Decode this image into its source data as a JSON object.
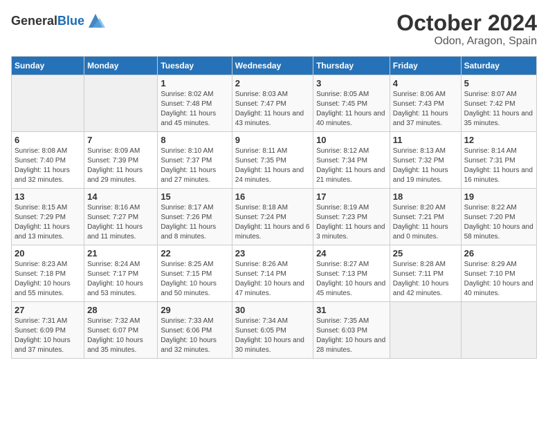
{
  "header": {
    "logo_general": "General",
    "logo_blue": "Blue",
    "title": "October 2024",
    "subtitle": "Odon, Aragon, Spain"
  },
  "days_of_week": [
    "Sunday",
    "Monday",
    "Tuesday",
    "Wednesday",
    "Thursday",
    "Friday",
    "Saturday"
  ],
  "weeks": [
    [
      {
        "day": "",
        "info": ""
      },
      {
        "day": "",
        "info": ""
      },
      {
        "day": "1",
        "info": "Sunrise: 8:02 AM\nSunset: 7:48 PM\nDaylight: 11 hours and 45 minutes."
      },
      {
        "day": "2",
        "info": "Sunrise: 8:03 AM\nSunset: 7:47 PM\nDaylight: 11 hours and 43 minutes."
      },
      {
        "day": "3",
        "info": "Sunrise: 8:05 AM\nSunset: 7:45 PM\nDaylight: 11 hours and 40 minutes."
      },
      {
        "day": "4",
        "info": "Sunrise: 8:06 AM\nSunset: 7:43 PM\nDaylight: 11 hours and 37 minutes."
      },
      {
        "day": "5",
        "info": "Sunrise: 8:07 AM\nSunset: 7:42 PM\nDaylight: 11 hours and 35 minutes."
      }
    ],
    [
      {
        "day": "6",
        "info": "Sunrise: 8:08 AM\nSunset: 7:40 PM\nDaylight: 11 hours and 32 minutes."
      },
      {
        "day": "7",
        "info": "Sunrise: 8:09 AM\nSunset: 7:39 PM\nDaylight: 11 hours and 29 minutes."
      },
      {
        "day": "8",
        "info": "Sunrise: 8:10 AM\nSunset: 7:37 PM\nDaylight: 11 hours and 27 minutes."
      },
      {
        "day": "9",
        "info": "Sunrise: 8:11 AM\nSunset: 7:35 PM\nDaylight: 11 hours and 24 minutes."
      },
      {
        "day": "10",
        "info": "Sunrise: 8:12 AM\nSunset: 7:34 PM\nDaylight: 11 hours and 21 minutes."
      },
      {
        "day": "11",
        "info": "Sunrise: 8:13 AM\nSunset: 7:32 PM\nDaylight: 11 hours and 19 minutes."
      },
      {
        "day": "12",
        "info": "Sunrise: 8:14 AM\nSunset: 7:31 PM\nDaylight: 11 hours and 16 minutes."
      }
    ],
    [
      {
        "day": "13",
        "info": "Sunrise: 8:15 AM\nSunset: 7:29 PM\nDaylight: 11 hours and 13 minutes."
      },
      {
        "day": "14",
        "info": "Sunrise: 8:16 AM\nSunset: 7:27 PM\nDaylight: 11 hours and 11 minutes."
      },
      {
        "day": "15",
        "info": "Sunrise: 8:17 AM\nSunset: 7:26 PM\nDaylight: 11 hours and 8 minutes."
      },
      {
        "day": "16",
        "info": "Sunrise: 8:18 AM\nSunset: 7:24 PM\nDaylight: 11 hours and 6 minutes."
      },
      {
        "day": "17",
        "info": "Sunrise: 8:19 AM\nSunset: 7:23 PM\nDaylight: 11 hours and 3 minutes."
      },
      {
        "day": "18",
        "info": "Sunrise: 8:20 AM\nSunset: 7:21 PM\nDaylight: 11 hours and 0 minutes."
      },
      {
        "day": "19",
        "info": "Sunrise: 8:22 AM\nSunset: 7:20 PM\nDaylight: 10 hours and 58 minutes."
      }
    ],
    [
      {
        "day": "20",
        "info": "Sunrise: 8:23 AM\nSunset: 7:18 PM\nDaylight: 10 hours and 55 minutes."
      },
      {
        "day": "21",
        "info": "Sunrise: 8:24 AM\nSunset: 7:17 PM\nDaylight: 10 hours and 53 minutes."
      },
      {
        "day": "22",
        "info": "Sunrise: 8:25 AM\nSunset: 7:15 PM\nDaylight: 10 hours and 50 minutes."
      },
      {
        "day": "23",
        "info": "Sunrise: 8:26 AM\nSunset: 7:14 PM\nDaylight: 10 hours and 47 minutes."
      },
      {
        "day": "24",
        "info": "Sunrise: 8:27 AM\nSunset: 7:13 PM\nDaylight: 10 hours and 45 minutes."
      },
      {
        "day": "25",
        "info": "Sunrise: 8:28 AM\nSunset: 7:11 PM\nDaylight: 10 hours and 42 minutes."
      },
      {
        "day": "26",
        "info": "Sunrise: 8:29 AM\nSunset: 7:10 PM\nDaylight: 10 hours and 40 minutes."
      }
    ],
    [
      {
        "day": "27",
        "info": "Sunrise: 7:31 AM\nSunset: 6:09 PM\nDaylight: 10 hours and 37 minutes."
      },
      {
        "day": "28",
        "info": "Sunrise: 7:32 AM\nSunset: 6:07 PM\nDaylight: 10 hours and 35 minutes."
      },
      {
        "day": "29",
        "info": "Sunrise: 7:33 AM\nSunset: 6:06 PM\nDaylight: 10 hours and 32 minutes."
      },
      {
        "day": "30",
        "info": "Sunrise: 7:34 AM\nSunset: 6:05 PM\nDaylight: 10 hours and 30 minutes."
      },
      {
        "day": "31",
        "info": "Sunrise: 7:35 AM\nSunset: 6:03 PM\nDaylight: 10 hours and 28 minutes."
      },
      {
        "day": "",
        "info": ""
      },
      {
        "day": "",
        "info": ""
      }
    ]
  ]
}
